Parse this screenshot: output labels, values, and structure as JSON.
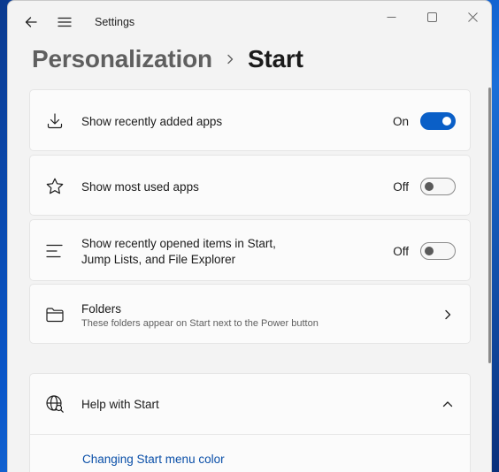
{
  "app": {
    "title": "Settings"
  },
  "breadcrumb": {
    "parent": "Personalization",
    "current": "Start"
  },
  "settings": [
    {
      "label": "Show recently added apps",
      "state": "On",
      "enabled": true,
      "icon": "download-icon"
    },
    {
      "label": "Show most used apps",
      "state": "Off",
      "enabled": false,
      "icon": "star-icon"
    },
    {
      "label_line1": "Show recently opened items in Start,",
      "label_line2": "Jump Lists, and File Explorer",
      "state": "Off",
      "enabled": false,
      "icon": "list-icon"
    }
  ],
  "folders": {
    "label": "Folders",
    "description": "These folders appear on Start next to the Power button",
    "icon": "folder-icon"
  },
  "help": {
    "label": "Help with Start",
    "link": "Changing Start menu color",
    "icon": "globe-search-icon"
  },
  "colors": {
    "accent": "#0a5fc7",
    "link": "#0a4fa8"
  }
}
